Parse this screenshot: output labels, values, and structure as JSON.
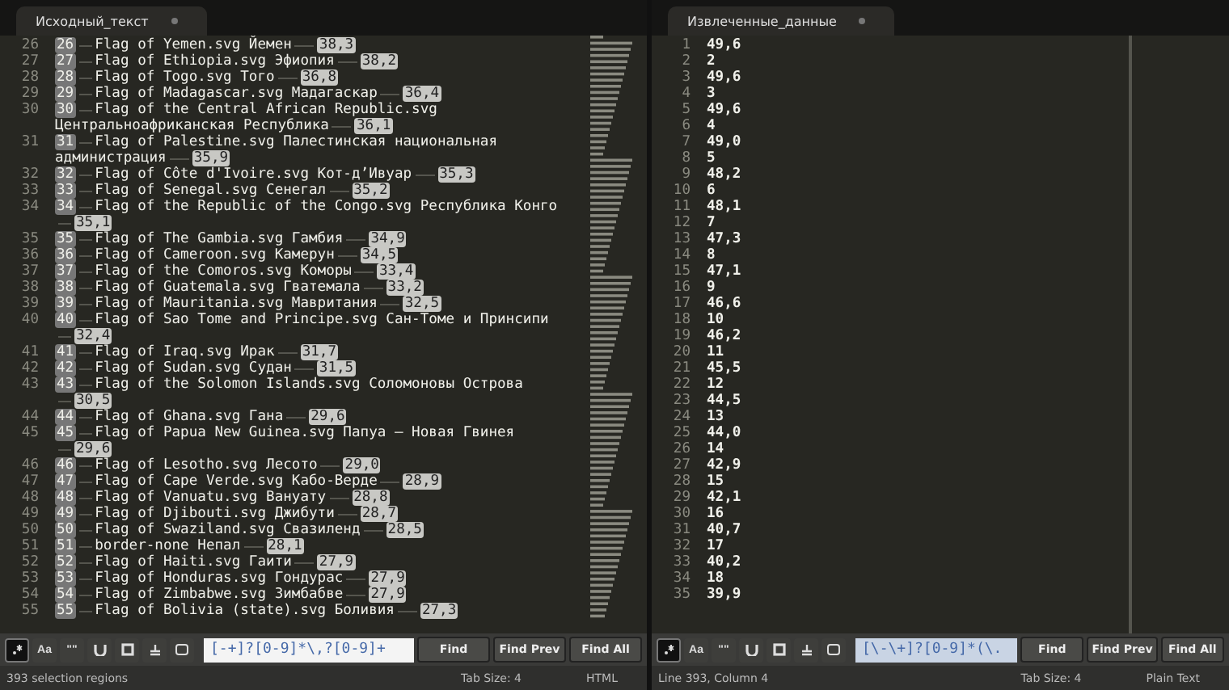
{
  "left_pane": {
    "tab": {
      "title": "Исходный_текст",
      "selected": true
    },
    "rows": [
      {
        "gutter": "26",
        "index": "26",
        "text": "Flag of Yemen.svg Йемен",
        "value": "38,3",
        "value_on_next_row": false
      },
      {
        "gutter": "27",
        "index": "27",
        "text": "Flag of Ethiopia.svg Эфиопия",
        "value": "38,2",
        "value_on_next_row": false
      },
      {
        "gutter": "28",
        "index": "28",
        "text": "Flag of Togo.svg Того",
        "value": "36,8",
        "value_on_next_row": false
      },
      {
        "gutter": "29",
        "index": "29",
        "text": "Flag of Madagascar.svg Мадагаскар",
        "value": "36,4",
        "value_on_next_row": false
      },
      {
        "gutter": "30",
        "index": "30",
        "text": "Flag of the Central African Republic.svg",
        "continuation": "Центральноафриканская Республика",
        "value": "36,1"
      },
      {
        "gutter": "31",
        "index": "31",
        "text": "Flag of Palestine.svg Палестинская национальная",
        "continuation": "администрация",
        "value": "35,9"
      },
      {
        "gutter": "32",
        "index": "32",
        "text": "Flag of Côte d'Ivoire.svg Кот-д’Ивуар",
        "value": "35,3",
        "value_on_next_row": false
      },
      {
        "gutter": "33",
        "index": "33",
        "text": "Flag of Senegal.svg Сенегал",
        "value": "35,2",
        "value_on_next_row": false
      },
      {
        "gutter": "34",
        "index": "34",
        "text": "Flag of the Republic of the Congo.svg Республика Конго",
        "value": "35,1",
        "value_on_next_row": true
      },
      {
        "gutter": "35",
        "index": "35",
        "text": "Flag of The Gambia.svg Гамбия",
        "value": "34,9",
        "value_on_next_row": false
      },
      {
        "gutter": "36",
        "index": "36",
        "text": "Flag of Cameroon.svg Камерун",
        "value": "34,5",
        "value_on_next_row": false
      },
      {
        "gutter": "37",
        "index": "37",
        "text": "Flag of the Comoros.svg Коморы",
        "value": "33,4",
        "value_on_next_row": false
      },
      {
        "gutter": "38",
        "index": "38",
        "text": "Flag of Guatemala.svg Гватемала",
        "value": "33,2",
        "value_on_next_row": false
      },
      {
        "gutter": "39",
        "index": "39",
        "text": "Flag of Mauritania.svg Мавритания",
        "value": "32,5",
        "value_on_next_row": false
      },
      {
        "gutter": "40",
        "index": "40",
        "text": "Flag of Sao Tome and Principe.svg Сан-Томе и Принсипи",
        "value": "32,4",
        "value_on_next_row": true
      },
      {
        "gutter": "41",
        "index": "41",
        "text": "Flag of Iraq.svg Ирак",
        "value": "31,7",
        "value_on_next_row": false
      },
      {
        "gutter": "42",
        "index": "42",
        "text": "Flag of Sudan.svg Судан",
        "value": "31,5",
        "value_on_next_row": false
      },
      {
        "gutter": "43",
        "index": "43",
        "text": "Flag of the Solomon Islands.svg Соломоновы Острова",
        "value": "30,5",
        "value_on_next_row": true
      },
      {
        "gutter": "44",
        "index": "44",
        "text": "Flag of Ghana.svg Гана",
        "value": "29,6",
        "value_on_next_row": false
      },
      {
        "gutter": "45",
        "index": "45",
        "text": "Flag of Papua New Guinea.svg Папуа — Новая Гвинея",
        "value": "29,6",
        "value_on_next_row": true
      },
      {
        "gutter": "46",
        "index": "46",
        "text": "Flag of Lesotho.svg Лесото",
        "value": "29,0",
        "value_on_next_row": false
      },
      {
        "gutter": "47",
        "index": "47",
        "text": "Flag of Cape Verde.svg Кабо-Верде",
        "value": "28,9",
        "value_on_next_row": false
      },
      {
        "gutter": "48",
        "index": "48",
        "text": "Flag of Vanuatu.svg Вануату",
        "value": "28,8",
        "value_on_next_row": false
      },
      {
        "gutter": "49",
        "index": "49",
        "text": "Flag of Djibouti.svg Джибути",
        "value": "28,7",
        "value_on_next_row": false
      },
      {
        "gutter": "50",
        "index": "50",
        "text": "Flag of Swaziland.svg Свазиленд",
        "value": "28,5",
        "value_on_next_row": false
      },
      {
        "gutter": "51",
        "index": "51",
        "text": "border-none Непал",
        "value": "28,1",
        "value_on_next_row": false
      },
      {
        "gutter": "52",
        "index": "52",
        "text": "Flag of Haiti.svg Гаити",
        "value": "27,9",
        "value_on_next_row": false
      },
      {
        "gutter": "53",
        "index": "53",
        "text": "Flag of Honduras.svg Гондурас",
        "value": "27,9",
        "value_on_next_row": false
      },
      {
        "gutter": "54",
        "index": "54",
        "text": "Flag of Zimbabwe.svg Зимбабве",
        "value": "27,9",
        "value_on_next_row": false
      },
      {
        "gutter": "55",
        "index": "55",
        "text": "Flag of Bolivia (state).svg Боливия",
        "value": "27,3",
        "value_on_next_row": false
      }
    ],
    "find_bar": {
      "options": [
        {
          "kind": "regex",
          "selected": true
        },
        {
          "kind": "case",
          "label": "Aa",
          "selected": false
        },
        {
          "kind": "word",
          "label": "\"\"",
          "selected": false
        },
        {
          "kind": "wrap",
          "selected": false
        },
        {
          "kind": "selection",
          "selected": false
        },
        {
          "kind": "highlight",
          "selected": false
        },
        {
          "kind": "panel",
          "selected": false
        }
      ],
      "query": "[-+]?[0-9]*\\,?[0-9]+",
      "buttons": [
        "Find",
        "Find Prev",
        "Find All"
      ]
    },
    "status_bar": {
      "left": "393 selection regions",
      "tab_size": "Tab Size: 4",
      "syntax": "HTML"
    }
  },
  "right_pane": {
    "tab": {
      "title": "Извлеченные_данные",
      "selected": true
    },
    "lines": [
      [
        "1",
        "49,6"
      ],
      [
        "2",
        "2"
      ],
      [
        "3",
        "49,6"
      ],
      [
        "4",
        "3"
      ],
      [
        "5",
        "49,6"
      ],
      [
        "6",
        "4"
      ],
      [
        "7",
        "49,0"
      ],
      [
        "8",
        "5"
      ],
      [
        "9",
        "48,2"
      ],
      [
        "10",
        "6"
      ],
      [
        "11",
        "48,1"
      ],
      [
        "12",
        "7"
      ],
      [
        "13",
        "47,3"
      ],
      [
        "14",
        "8"
      ],
      [
        "15",
        "47,1"
      ],
      [
        "16",
        "9"
      ],
      [
        "17",
        "46,6"
      ],
      [
        "18",
        "10"
      ],
      [
        "19",
        "46,2"
      ],
      [
        "20",
        "11"
      ],
      [
        "21",
        "45,5"
      ],
      [
        "22",
        "12"
      ],
      [
        "23",
        "44,5"
      ],
      [
        "24",
        "13"
      ],
      [
        "25",
        "44,0"
      ],
      [
        "26",
        "14"
      ],
      [
        "27",
        "42,9"
      ],
      [
        "28",
        "15"
      ],
      [
        "29",
        "42,1"
      ],
      [
        "30",
        "16"
      ],
      [
        "31",
        "40,7"
      ],
      [
        "32",
        "17"
      ],
      [
        "33",
        "40,2"
      ],
      [
        "34",
        "18"
      ],
      [
        "35",
        "39,9"
      ]
    ],
    "find_bar": {
      "options": [
        {
          "kind": "regex",
          "selected": true
        },
        {
          "kind": "case",
          "label": "Aa",
          "selected": false
        },
        {
          "kind": "word",
          "label": "\"\"",
          "selected": false
        },
        {
          "kind": "wrap",
          "selected": false
        },
        {
          "kind": "selection",
          "selected": false
        },
        {
          "kind": "highlight",
          "selected": false
        },
        {
          "kind": "panel",
          "selected": false
        }
      ],
      "query": "[\\-\\+]?[0-9]*(\\.",
      "buttons": [
        "Find",
        "Find Prev",
        "Find All"
      ]
    },
    "status_bar": {
      "left": "Line 393, Column 4",
      "tab_size": "Tab Size: 4",
      "syntax": "Plain Text"
    }
  }
}
